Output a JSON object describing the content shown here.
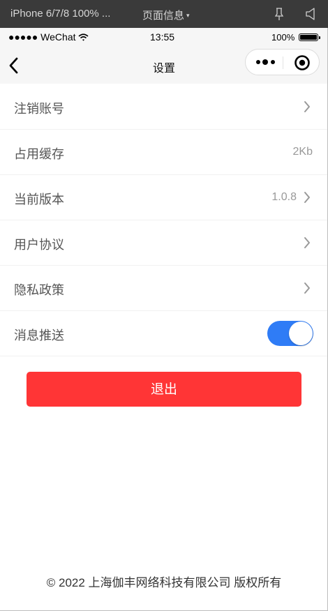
{
  "devtools": {
    "device": "iPhone 6/7/8 100% ...",
    "page_info": "页面信息",
    "caret": "▾"
  },
  "status_bar": {
    "signal": "●●●●● WeChat",
    "time": "13:55",
    "battery_percent": "100%"
  },
  "nav": {
    "title": "设置"
  },
  "settings": {
    "items": [
      {
        "label": "注销账号",
        "value": ""
      },
      {
        "label": "占用缓存",
        "value": "2Kb"
      },
      {
        "label": "当前版本",
        "value": "1.0.8"
      },
      {
        "label": "用户协议",
        "value": ""
      },
      {
        "label": "隐私政策",
        "value": ""
      },
      {
        "label": "消息推送",
        "toggle_on": true
      }
    ]
  },
  "logout_label": "退出",
  "footer": "© 2022 上海伽丰网络科技有限公司 版权所有",
  "colors": {
    "accent_toggle": "#2f7cf6",
    "logout_button": "#ff3536"
  }
}
